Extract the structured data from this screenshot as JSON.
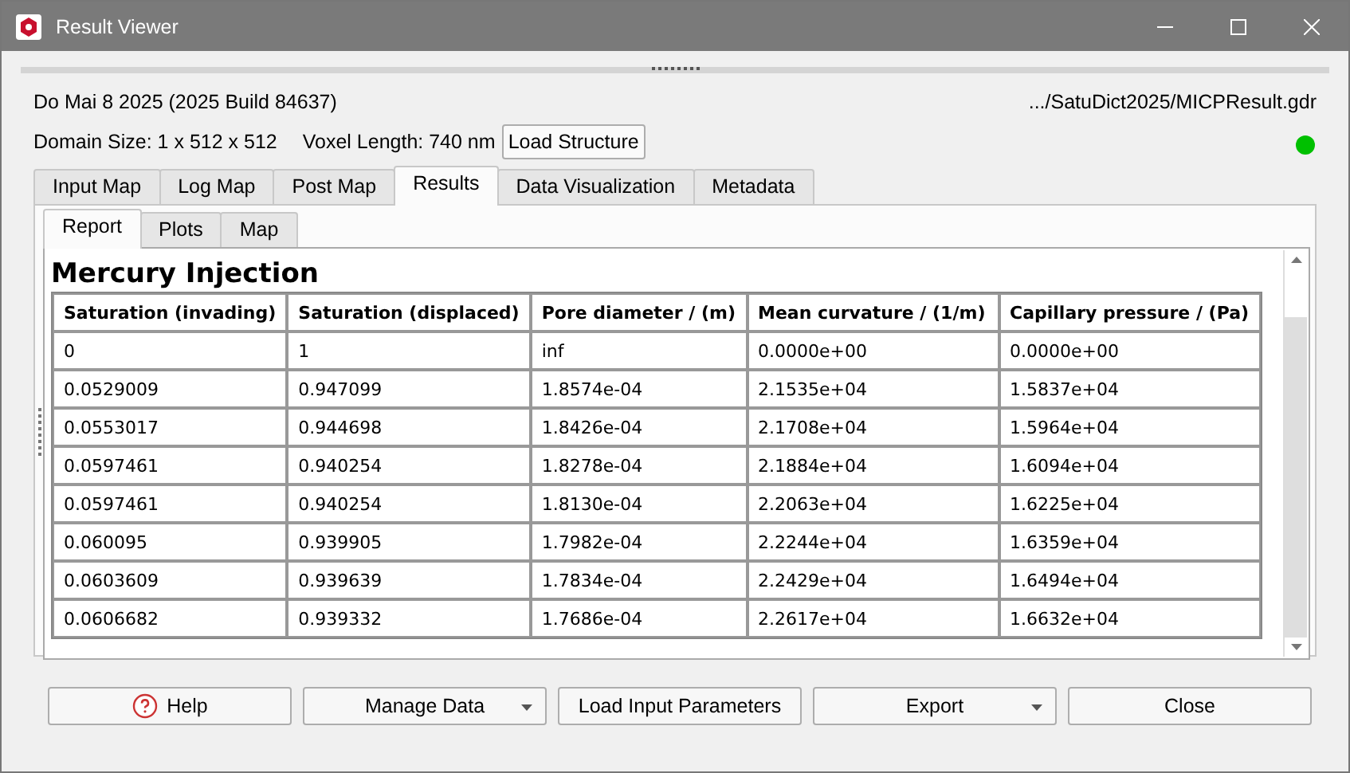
{
  "window": {
    "title": "Result Viewer"
  },
  "info": {
    "build": "Do Mai 8 2025 (2025 Build 84637)",
    "path": ".../SatuDict2025/MICPResult.gdr",
    "domain_size": "Domain Size: 1 x 512 x 512",
    "voxel_length": "Voxel Length: 740 nm",
    "load_button": "Load Structure",
    "status": {
      "color": "#00c000"
    }
  },
  "tabs": [
    {
      "label": "Input Map",
      "selected": false
    },
    {
      "label": "Log Map",
      "selected": false
    },
    {
      "label": "Post Map",
      "selected": false
    },
    {
      "label": "Results",
      "selected": true
    },
    {
      "label": "Data Visualization",
      "selected": false
    },
    {
      "label": "Metadata",
      "selected": false
    }
  ],
  "subtabs": [
    {
      "label": "Report",
      "selected": true
    },
    {
      "label": "Plots",
      "selected": false
    },
    {
      "label": "Map",
      "selected": false
    }
  ],
  "report": {
    "title": "Mercury Injection",
    "columns": [
      "Saturation (invading)",
      "Saturation (displaced)",
      "Pore diameter / (m)",
      "Mean curvature / (1/m)",
      "Capillary pressure / (Pa)"
    ],
    "rows": [
      [
        "0",
        "1",
        "inf",
        "0.0000e+00",
        "0.0000e+00"
      ],
      [
        "0.0529009",
        "0.947099",
        "1.8574e-04",
        "2.1535e+04",
        "1.5837e+04"
      ],
      [
        "0.0553017",
        "0.944698",
        "1.8426e-04",
        "2.1708e+04",
        "1.5964e+04"
      ],
      [
        "0.0597461",
        "0.940254",
        "1.8278e-04",
        "2.1884e+04",
        "1.6094e+04"
      ],
      [
        "0.0597461",
        "0.940254",
        "1.8130e-04",
        "2.2063e+04",
        "1.6225e+04"
      ],
      [
        "0.060095",
        "0.939905",
        "1.7982e-04",
        "2.2244e+04",
        "1.6359e+04"
      ],
      [
        "0.0603609",
        "0.939639",
        "1.7834e-04",
        "2.2429e+04",
        "1.6494e+04"
      ],
      [
        "0.0606682",
        "0.939332",
        "1.7686e-04",
        "2.2617e+04",
        "1.6632e+04"
      ]
    ]
  },
  "buttons": [
    {
      "label": "Help",
      "kind": "help"
    },
    {
      "label": "Manage Data",
      "kind": "dropdown"
    },
    {
      "label": "Load Input Parameters",
      "kind": "plain"
    },
    {
      "label": "Export",
      "kind": "dropdown"
    },
    {
      "label": "Close",
      "kind": "plain"
    }
  ]
}
